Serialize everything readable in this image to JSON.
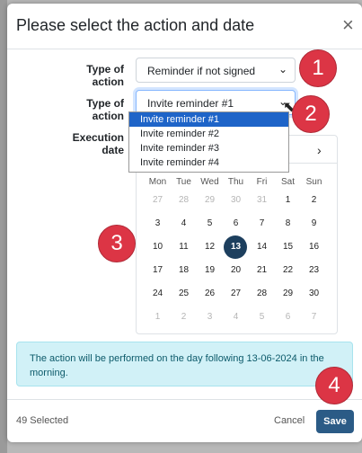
{
  "modal": {
    "title": "Please select the action and date",
    "close_glyph": "×"
  },
  "form": {
    "type_of_action_label_1": "Type of action",
    "type_of_action_value_1": "Reminder if not signed",
    "type_of_action_label_2": "Type of action",
    "type_of_action_value_2": "Invite reminder #1",
    "execution_date_label": "Execution date",
    "dropdown_options": [
      "Invite reminder #1",
      "Invite reminder #2",
      "Invite reminder #3",
      "Invite reminder #4"
    ],
    "chevron_glyph": "⌄"
  },
  "calendar": {
    "next_glyph": "›",
    "weekdays": [
      "Mon",
      "Tue",
      "Wed",
      "Thu",
      "Fri",
      "Sat",
      "Sun"
    ],
    "weeks": [
      [
        "27",
        "28",
        "29",
        "30",
        "31",
        "1",
        "2"
      ],
      [
        "3",
        "4",
        "5",
        "6",
        "7",
        "8",
        "9"
      ],
      [
        "10",
        "11",
        "12",
        "13",
        "14",
        "15",
        "16"
      ],
      [
        "17",
        "18",
        "19",
        "20",
        "21",
        "22",
        "23"
      ],
      [
        "24",
        "25",
        "26",
        "27",
        "28",
        "29",
        "30"
      ],
      [
        "1",
        "2",
        "3",
        "4",
        "5",
        "6",
        "7"
      ]
    ],
    "selected_day": "13"
  },
  "info": {
    "text": "The action will be performed on the day following 13-06-2024 in the morning."
  },
  "footer": {
    "selected_count": "49 Selected",
    "cancel_label": "Cancel",
    "save_label": "Save"
  },
  "badges": [
    "1",
    "2",
    "3",
    "4"
  ],
  "cursor_glyph": "⬉",
  "colors": {
    "primary": "#2b5b86",
    "badge": "#dc3545",
    "dropdown_active": "#1e64c8",
    "info_bg": "#d1f1f7"
  }
}
